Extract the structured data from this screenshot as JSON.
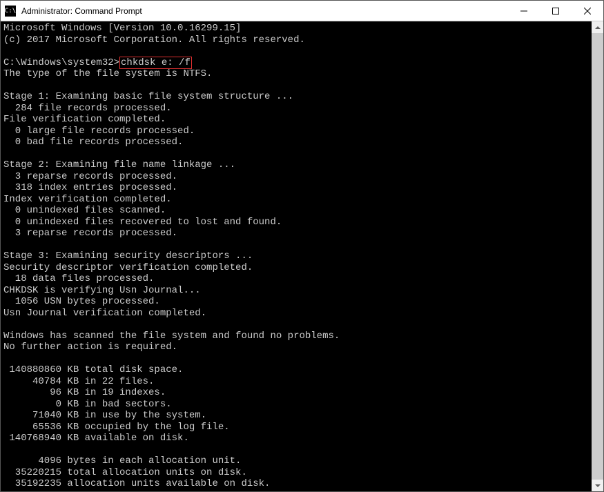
{
  "title": "Administrator: Command Prompt",
  "icon_label": "C:\\",
  "prompt": "C:\\Windows\\system32>",
  "command": "chkdsk e: /f",
  "lines_before": [
    "Microsoft Windows [Version 10.0.16299.15]",
    "(c) 2017 Microsoft Corporation. All rights reserved.",
    ""
  ],
  "lines_after": [
    "The type of the file system is NTFS.",
    "",
    "Stage 1: Examining basic file system structure ...",
    "  284 file records processed.",
    "File verification completed.",
    "  0 large file records processed.",
    "  0 bad file records processed.",
    "",
    "Stage 2: Examining file name linkage ...",
    "  3 reparse records processed.",
    "  318 index entries processed.",
    "Index verification completed.",
    "  0 unindexed files scanned.",
    "  0 unindexed files recovered to lost and found.",
    "  3 reparse records processed.",
    "",
    "Stage 3: Examining security descriptors ...",
    "Security descriptor verification completed.",
    "  18 data files processed.",
    "CHKDSK is verifying Usn Journal...",
    "  1056 USN bytes processed.",
    "Usn Journal verification completed.",
    "",
    "Windows has scanned the file system and found no problems.",
    "No further action is required.",
    "",
    " 140880860 KB total disk space.",
    "     40784 KB in 22 files.",
    "        96 KB in 19 indexes.",
    "         0 KB in bad sectors.",
    "     71040 KB in use by the system.",
    "     65536 KB occupied by the log file.",
    " 140768940 KB available on disk.",
    "",
    "      4096 bytes in each allocation unit.",
    "  35220215 total allocation units on disk.",
    "  35192235 allocation units available on disk."
  ]
}
